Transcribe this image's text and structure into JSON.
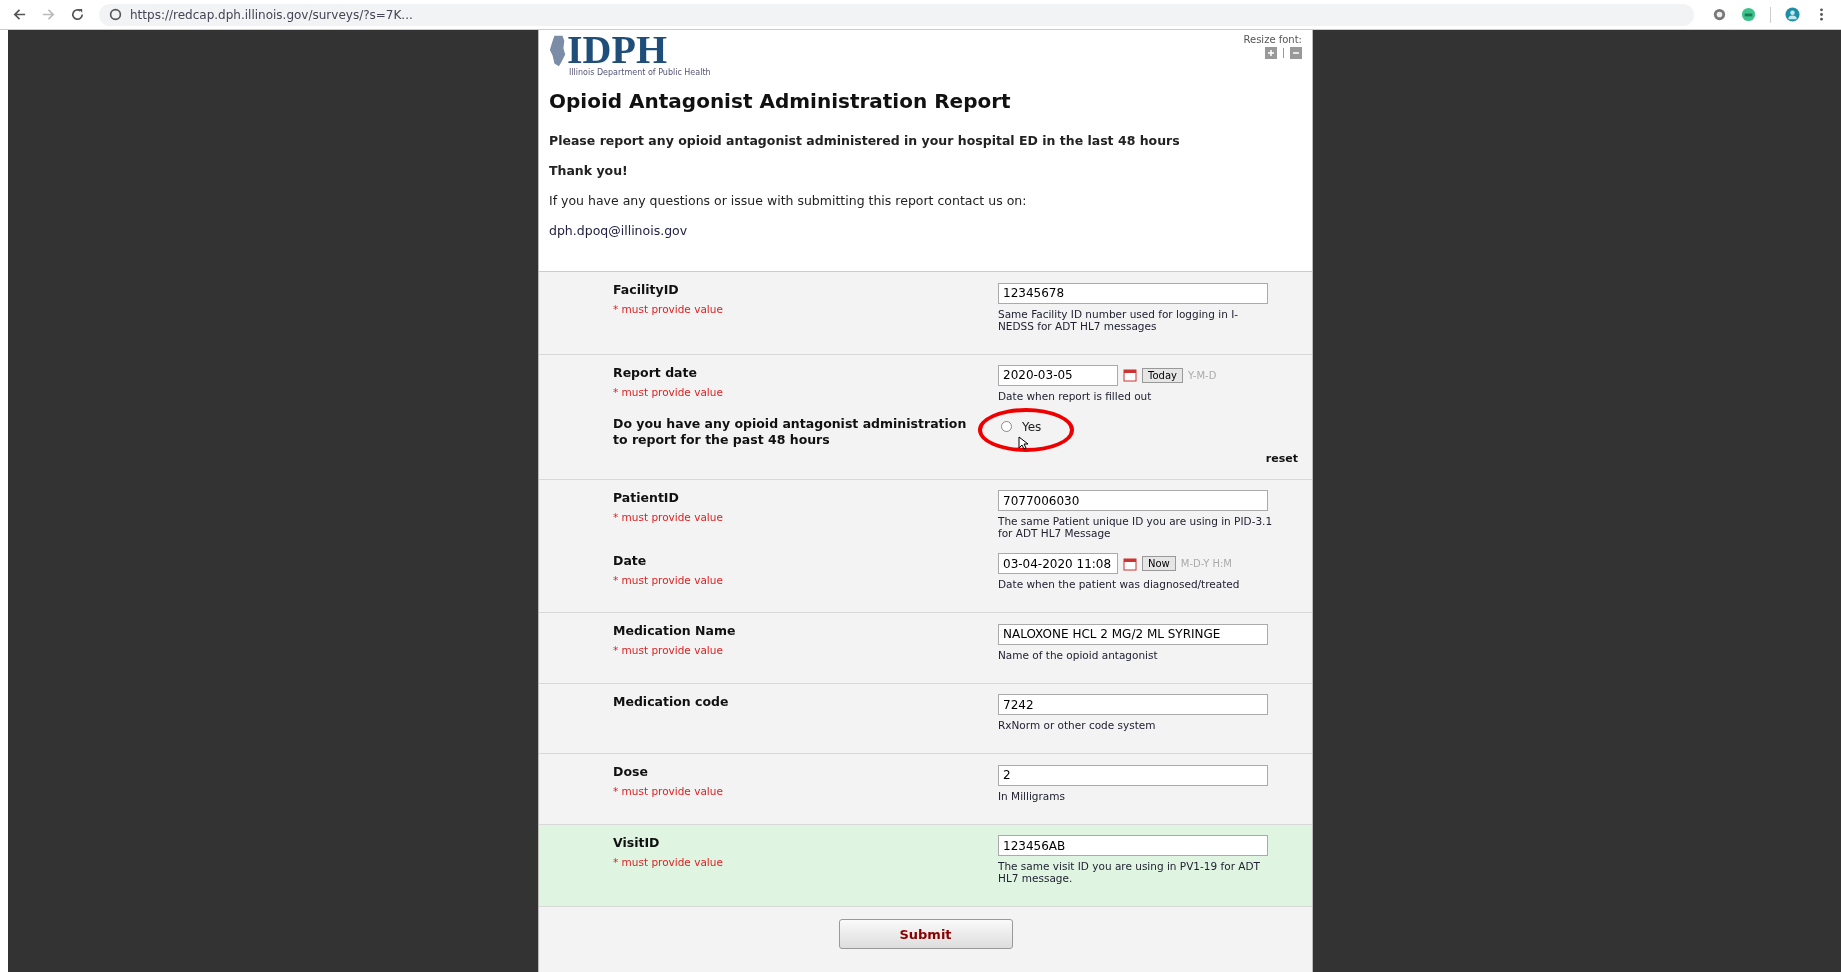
{
  "browser": {
    "url": "https://redcap.dph.illinois.gov/surveys/?s=7K..."
  },
  "header": {
    "logo": "IDPH",
    "logo_tagline": "Illinois Department of Public Health",
    "resize_font": "Resize font:"
  },
  "title": "Opioid Antagonist Administration Report",
  "intro": [
    {
      "text": "Please report any opioid antagonist administered in your hospital ED in the last 48 hours",
      "bold": true
    },
    {
      "text": "Thank you!",
      "bold": true
    },
    {
      "text": "If you have any questions or issue with submitting this report contact us on:",
      "bold": false
    }
  ],
  "contact_link": "dph.dpoq@illinois.gov",
  "sections": [
    {
      "highlighted": false,
      "fields": [
        {
          "kind": "text",
          "label": "FacilityID",
          "required": "* must provide value",
          "value": "12345678",
          "note": "Same Facility ID number used for logging in I-NEDSS for ADT HL7 messages"
        }
      ]
    },
    {
      "highlighted": false,
      "fields": [
        {
          "kind": "date",
          "label": "Report date",
          "required": "* must provide value",
          "value": "2020-03-05",
          "button": "Today",
          "format": "Y-M-D",
          "note": "Date when report is filled out"
        },
        {
          "kind": "radio",
          "label": "Do you have any opioid antagonist administration to report for the past 48 hours",
          "options": [
            {
              "label": "Yes",
              "selected": false
            }
          ],
          "reset": "reset"
        }
      ]
    },
    {
      "highlighted": false,
      "fields": [
        {
          "kind": "text",
          "label": "PatientID",
          "required": "* must provide value",
          "value": "7077006030",
          "note": "The same Patient unique ID you are using in PID-3.1 for ADT HL7 Message"
        },
        {
          "kind": "date",
          "label": "Date",
          "required": "* must provide value",
          "value": "03-04-2020 11:08",
          "button": "Now",
          "format": "M-D-Y H:M",
          "note": "Date when the patient was diagnosed/treated"
        }
      ]
    },
    {
      "highlighted": false,
      "fields": [
        {
          "kind": "text",
          "label": "Medication Name",
          "required": "* must provide value",
          "value": "NALOXONE HCL 2 MG/2 ML SYRINGE",
          "note": "Name of the opioid antagonist"
        }
      ]
    },
    {
      "highlighted": false,
      "fields": [
        {
          "kind": "text",
          "label": "Medication code",
          "value": "7242",
          "note": "RxNorm or other code system"
        }
      ]
    },
    {
      "highlighted": false,
      "fields": [
        {
          "kind": "text",
          "label": "Dose",
          "required": "* must provide value",
          "value": "2",
          "note": "In Milligrams"
        }
      ]
    },
    {
      "highlighted": true,
      "fields": [
        {
          "kind": "text",
          "label": "VisitID",
          "required": "* must provide value",
          "value": "123456AB",
          "note": "The same visit ID you are using in PV1-19 for ADT HL7 message."
        }
      ]
    }
  ],
  "submit": "Submit"
}
